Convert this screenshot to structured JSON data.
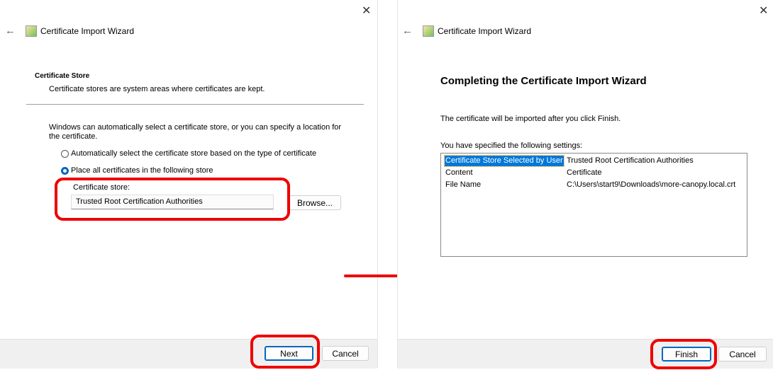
{
  "left_window": {
    "title": "Certificate Import Wizard",
    "section_title": "Certificate Store",
    "section_subtitle": "Certificate stores are system areas where certificates are kept.",
    "description": "Windows can automatically select a certificate store, or you can specify a location for the certificate.",
    "radio_auto": "Automatically select the certificate store based on the type of certificate",
    "radio_place": "Place all certificates in the following store",
    "store_label": "Certificate store:",
    "store_value": "Trusted Root Certification Authorities",
    "browse_label": "Browse...",
    "next_label": "Next",
    "cancel_label": "Cancel"
  },
  "right_window": {
    "title": "Certificate Import Wizard",
    "heading": "Completing the Certificate Import Wizard",
    "intro": "The certificate will be imported after you click Finish.",
    "settings_label": "You have specified the following settings:",
    "settings": [
      {
        "name": "Certificate Store Selected by User",
        "value": "Trusted Root Certification Authorities"
      },
      {
        "name": "Content",
        "value": "Certificate"
      },
      {
        "name": "File Name",
        "value": "C:\\Users\\start9\\Downloads\\more-canopy.local.crt"
      }
    ],
    "finish_label": "Finish",
    "cancel_label": "Cancel"
  },
  "colors": {
    "accent": "#0067c0",
    "highlight": "#ee0000",
    "selection": "#0078d7"
  }
}
